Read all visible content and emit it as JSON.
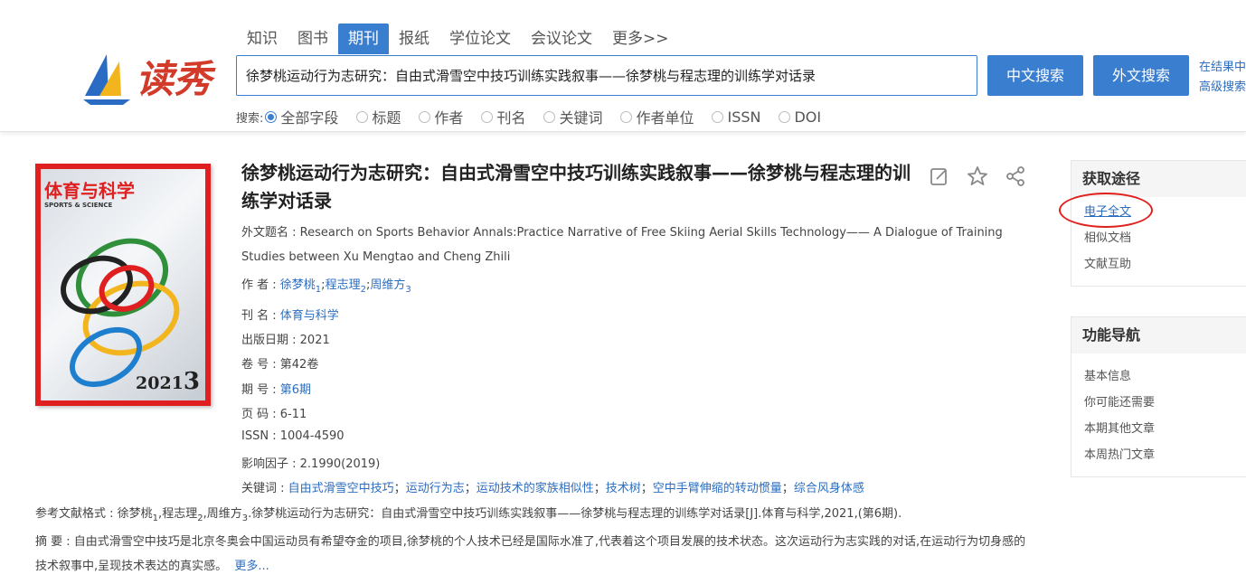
{
  "header": {
    "logo_text": "读秀",
    "tabs": [
      "知识",
      "图书",
      "期刊",
      "报纸",
      "学位论文",
      "会议论文",
      "更多>>"
    ],
    "active_tab": "期刊",
    "search_value": "徐梦桃运动行为志研究：自由式滑雪空中技巧训练实践叙事——徐梦桃与程志理的训练学对话录",
    "btn_cn": "中文搜索",
    "btn_foreign": "外文搜索",
    "link_in_results": "在结果中",
    "link_advanced": "高级搜索",
    "fields_label": "搜索:",
    "fields": [
      "全部字段",
      "标题",
      "作者",
      "刊名",
      "关键词",
      "作者单位",
      "ISSN",
      "DOI"
    ],
    "selected_field": "全部字段"
  },
  "cover": {
    "title": "体育与科学",
    "subtitle": "SPORTS & SCIENCE",
    "year": "2021",
    "issue": "3"
  },
  "article": {
    "title": "徐梦桃运动行为志研究：自由式滑雪空中技巧训练实践叙事——徐梦桃与程志理的训练学对话录",
    "foreign_title_label": "外文题名 : ",
    "foreign_title": "Research on Sports Behavior Annals:Practice Narrative of Free Skiing Aerial Skills Technology—— A Dialogue of Training Studies between Xu Mengtao and Cheng Zhili",
    "authors_label": "作  者 : ",
    "authors": [
      {
        "name": "徐梦桃",
        "sub": "1"
      },
      {
        "name": "程志理",
        "sub": "2"
      },
      {
        "name": "周维方",
        "sub": "3"
      }
    ],
    "journal_label": "刊  名 : ",
    "journal": "体育与科学",
    "date_label": "出版日期 : ",
    "date": "2021",
    "volume_label": "卷  号 : ",
    "volume": "第42卷",
    "issue_label": "期  号 : ",
    "issue": "第6期",
    "pages_label": "页  码 : ",
    "pages": "6-11",
    "issn_label": "ISSN : ",
    "issn": "1004-4590",
    "impact_label": "影响因子 : ",
    "impact": "2.1990(2019)",
    "keywords_label": "关键词 : ",
    "keywords": [
      "自由式滑雪空中技巧",
      "运动行为志",
      "运动技术的家族相似性",
      "技术树",
      "空中手臂伸缩的转动惯量",
      "综合风身体感"
    ],
    "citation_label": "参考文献格式 : ",
    "citation_authors": [
      {
        "name": "徐梦桃",
        "sub": "1"
      },
      {
        "name": "程志理",
        "sub": "2"
      },
      {
        "name": "周维方",
        "sub": "3"
      }
    ],
    "citation_rest": ".徐梦桃运动行为志研究：自由式滑雪空中技巧训练实践叙事——徐梦桃与程志理的训练学对话录[J].体育与科学,2021,(第6期).",
    "abstract_label": "摘  要 : ",
    "abstract": "自由式滑雪空中技巧是北京冬奥会中国运动员有希望夺金的项目,徐梦桃的个人技术已经是国际水准了,代表着这个项目发展的技术状态。这次运动行为志实践的对话,在运动行为切身感的技术叙事中,呈现技术表达的真实感。",
    "more": "更多..."
  },
  "sidebar": {
    "access_title": "获取途径",
    "access_items": [
      "电子全文",
      "相似文档",
      "文献互助"
    ],
    "nav_title": "功能导航",
    "nav_items": [
      "基本信息",
      "你可能还需要",
      "本期其他文章",
      "本周热门文章"
    ]
  },
  "colors": {
    "accent": "#3a7ed0",
    "link": "#2c6dbf",
    "highlight_circle": "#e0201c"
  }
}
